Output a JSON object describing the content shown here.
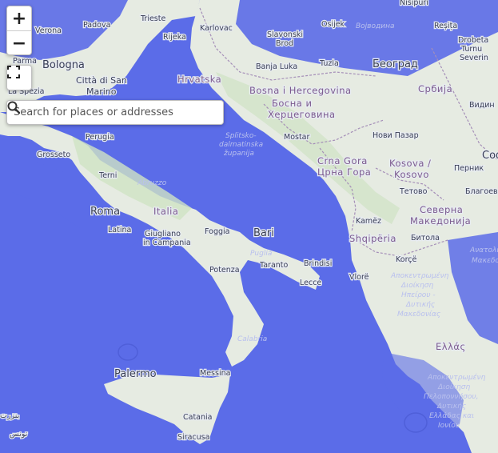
{
  "colors": {
    "water": "#5b6ce8",
    "water_dark": "#4f5fd9",
    "land": "#e6ebe2",
    "land_green": "#cfe3c4",
    "border": "#a58fb8"
  },
  "controls": {
    "zoom_in_label": "+",
    "zoom_out_label": "−",
    "fullscreen_icon": "fullscreen-icon",
    "search_placeholder": "Search for places or addresses",
    "search_value": "",
    "search_icon": "search-icon"
  },
  "places": {
    "padova": "Padova",
    "verona": "Verona",
    "trieste": "Trieste",
    "rijeka": "Rijeka",
    "karlovac": "Karlovac",
    "slavonski_brod": "Slavonski",
    "slavonski_brod2": "Brod",
    "osijek": "Osijek",
    "vojvodina": "Војводина",
    "nisipuri": "Nisipuri",
    "resita": "Reșița",
    "drobeta": "Drobeta",
    "turnu": "Turnu",
    "severin": "Severin",
    "parma": "Parma",
    "bologna": "Bologna",
    "citta_san_marino": "Città di San",
    "citta_san_marino2": "Marino",
    "la_spezia": "La Spezia",
    "hrvatska": "Hrvatska",
    "banja_luka": "Banja Luka",
    "tuzla": "Tuzla",
    "beograd": "Београд",
    "srbija": "Србија",
    "vidin": "Видин",
    "bih1": "Bosna i Hercegovina",
    "bih2": "Босна и",
    "bih3": "Херцеговина",
    "grosseto": "Grosseto",
    "perugia": "Perugia",
    "split_sea": "Splitsko-",
    "split_sea2": "dalmatinska",
    "split_sea3": "županija",
    "mostar": "Mostar",
    "novi_pazar": "Нови Пазар",
    "cg1": "Crna Gora",
    "cg2": "Црна Гора",
    "kosova1": "Kosova /",
    "kosova2": "Kosovo",
    "pernik": "Перник",
    "sofia": "Соф",
    "terni": "Terni",
    "abruzzo": "Abruzzo",
    "roma": "Roma",
    "italia": "Italia",
    "tetovo": "Тетово",
    "blagoevgrad": "Благоев",
    "sev_mak1": "Северна",
    "sev_mak2": "Македонија",
    "latina": "Latina",
    "giugliano1": "Giugliano",
    "giugliano2": "in Campania",
    "foggia": "Foggia",
    "bari": "Bari",
    "kamez": "Kamëz",
    "shqiperia": "Shqipëria",
    "bitola": "Битола",
    "puglia": "Puglia",
    "taranto": "Taranto",
    "brindisi": "Brindisi",
    "potenza": "Potenza",
    "lecce": "Lecce",
    "korce": "Korçë",
    "vlore": "Vlorë",
    "ana_mak1": "Ανατολική",
    "ana_mak2": "Μακεδονία",
    "apok1": "Αποκεντρωμένη",
    "apok2": "Διοίκηση",
    "apok3": "Ηπείρου -",
    "apok4": "Δυτικής",
    "apok5": "Μακεδονίας",
    "calabria": "Calabria",
    "ellas": "Ελλάς",
    "palermo": "Palermo",
    "messina": "Messina",
    "apok_pel1": "Αποκεντρωμένη",
    "apok_pel2": "Διοίκηση",
    "apok_pel3": "Πελοποννήσου,",
    "apok_pel4": "Δυτικής",
    "apok_pel5": "Ελλάδας και",
    "apok_pel6": "Ιονίου",
    "catania": "Catania",
    "siracusa": "Siracusa",
    "bizerte": "بنزرت",
    "tunis": "تونس"
  }
}
